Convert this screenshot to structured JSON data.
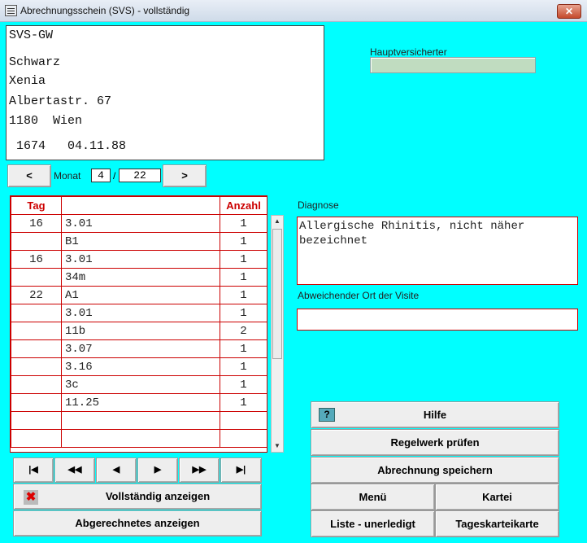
{
  "window": {
    "title": "Abrechnungsschein (SVS) - vollständig",
    "close_label": "✕"
  },
  "address": {
    "insurer": "SVS-GW",
    "lastname": "Schwarz",
    "firstname": "Xenia",
    "street": "Albertastr. 67",
    "city": "1180  Wien",
    "id_line": " 1674   04.11.88"
  },
  "hauptversicherter": {
    "label": "Hauptversicherter",
    "value": ""
  },
  "month_nav": {
    "prev": "<",
    "label": "Monat",
    "month": "4",
    "sep": "/",
    "year": "22",
    "next": ">"
  },
  "table": {
    "headers": {
      "tag": "Tag",
      "code": "",
      "anzahl": "Anzahl"
    },
    "rows": [
      {
        "tag": "16",
        "code": "3.01",
        "anzahl": "1"
      },
      {
        "tag": "",
        "code": "B1",
        "anzahl": "1"
      },
      {
        "tag": "16",
        "code": "3.01",
        "anzahl": "1"
      },
      {
        "tag": "",
        "code": "34m",
        "anzahl": "1"
      },
      {
        "tag": "22",
        "code": "A1",
        "anzahl": "1"
      },
      {
        "tag": "",
        "code": "3.01",
        "anzahl": "1"
      },
      {
        "tag": "",
        "code": "11b",
        "anzahl": "2"
      },
      {
        "tag": "",
        "code": "3.07",
        "anzahl": "1"
      },
      {
        "tag": "",
        "code": "3.16",
        "anzahl": "1"
      },
      {
        "tag": "",
        "code": "3c",
        "anzahl": "1"
      },
      {
        "tag": "",
        "code": "11.25",
        "anzahl": "1"
      },
      {
        "tag": "",
        "code": "",
        "anzahl": ""
      },
      {
        "tag": "",
        "code": "",
        "anzahl": ""
      }
    ]
  },
  "scrollbar": {
    "up": "▲",
    "down": "▼"
  },
  "record_nav": {
    "first": "|◀",
    "rew": "◀◀",
    "prev": "◀",
    "next": "▶",
    "ff": "▶▶",
    "last": "▶|"
  },
  "buttons": {
    "vollstaendig": "Vollständig anzeigen",
    "abgerechnet": "Abgerechnetes anzeigen",
    "hilfe": "Hilfe",
    "regelwerk": "Regelwerk prüfen",
    "speichern": "Abrechnung speichern",
    "menu": "Menü",
    "kartei": "Kartei",
    "liste": "Liste - unerledigt",
    "tageskartei": "Tageskarteikarte"
  },
  "icons": {
    "help": "?",
    "cancel": "✖"
  },
  "diagnose": {
    "label": "Diagnose",
    "value": "Allergische Rhinitis, nicht näher bezeichnet"
  },
  "visite": {
    "label": "Abweichender Ort der Visite",
    "value": ""
  }
}
